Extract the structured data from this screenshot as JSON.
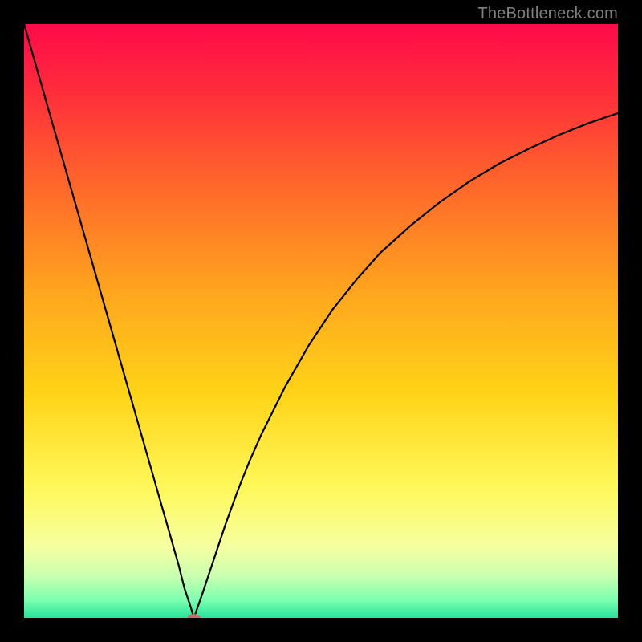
{
  "watermark": "TheBottleneck.com",
  "chart_data": {
    "type": "line",
    "title": "",
    "xlabel": "",
    "ylabel": "",
    "xlim": [
      0,
      100
    ],
    "ylim": [
      0,
      100
    ],
    "background_gradient": {
      "type": "vertical",
      "stops": [
        {
          "pos": 0.0,
          "color": "#ff0a4a"
        },
        {
          "pos": 0.12,
          "color": "#ff2f3a"
        },
        {
          "pos": 0.28,
          "color": "#ff6a2a"
        },
        {
          "pos": 0.45,
          "color": "#ffa51e"
        },
        {
          "pos": 0.62,
          "color": "#ffd317"
        },
        {
          "pos": 0.78,
          "color": "#fff85a"
        },
        {
          "pos": 0.88,
          "color": "#f6ffa0"
        },
        {
          "pos": 0.93,
          "color": "#c8ffb0"
        },
        {
          "pos": 0.97,
          "color": "#7dffb0"
        },
        {
          "pos": 1.0,
          "color": "#26e39a"
        }
      ]
    },
    "series": [
      {
        "name": "left-branch",
        "x": [
          0,
          2,
          4,
          6,
          8,
          10,
          12,
          14,
          16,
          18,
          20,
          22,
          24,
          26,
          27,
          28,
          28.6
        ],
        "y": [
          100,
          93,
          86,
          79,
          72,
          65,
          58,
          51,
          44,
          37,
          30,
          23,
          16,
          9,
          5,
          2,
          0
        ]
      },
      {
        "name": "right-branch",
        "x": [
          28.6,
          30,
          32,
          34,
          36,
          38,
          40,
          44,
          48,
          52,
          56,
          60,
          65,
          70,
          75,
          80,
          85,
          90,
          95,
          100
        ],
        "y": [
          0,
          4,
          10,
          16,
          21.5,
          26.5,
          31,
          39,
          46,
          52,
          57,
          61.5,
          66,
          70,
          73.5,
          76.5,
          79,
          81.3,
          83.3,
          85
        ]
      }
    ],
    "marker": {
      "x": 28.6,
      "y": 0,
      "color": "#c66a6a",
      "rx": 8,
      "ry": 5
    }
  }
}
